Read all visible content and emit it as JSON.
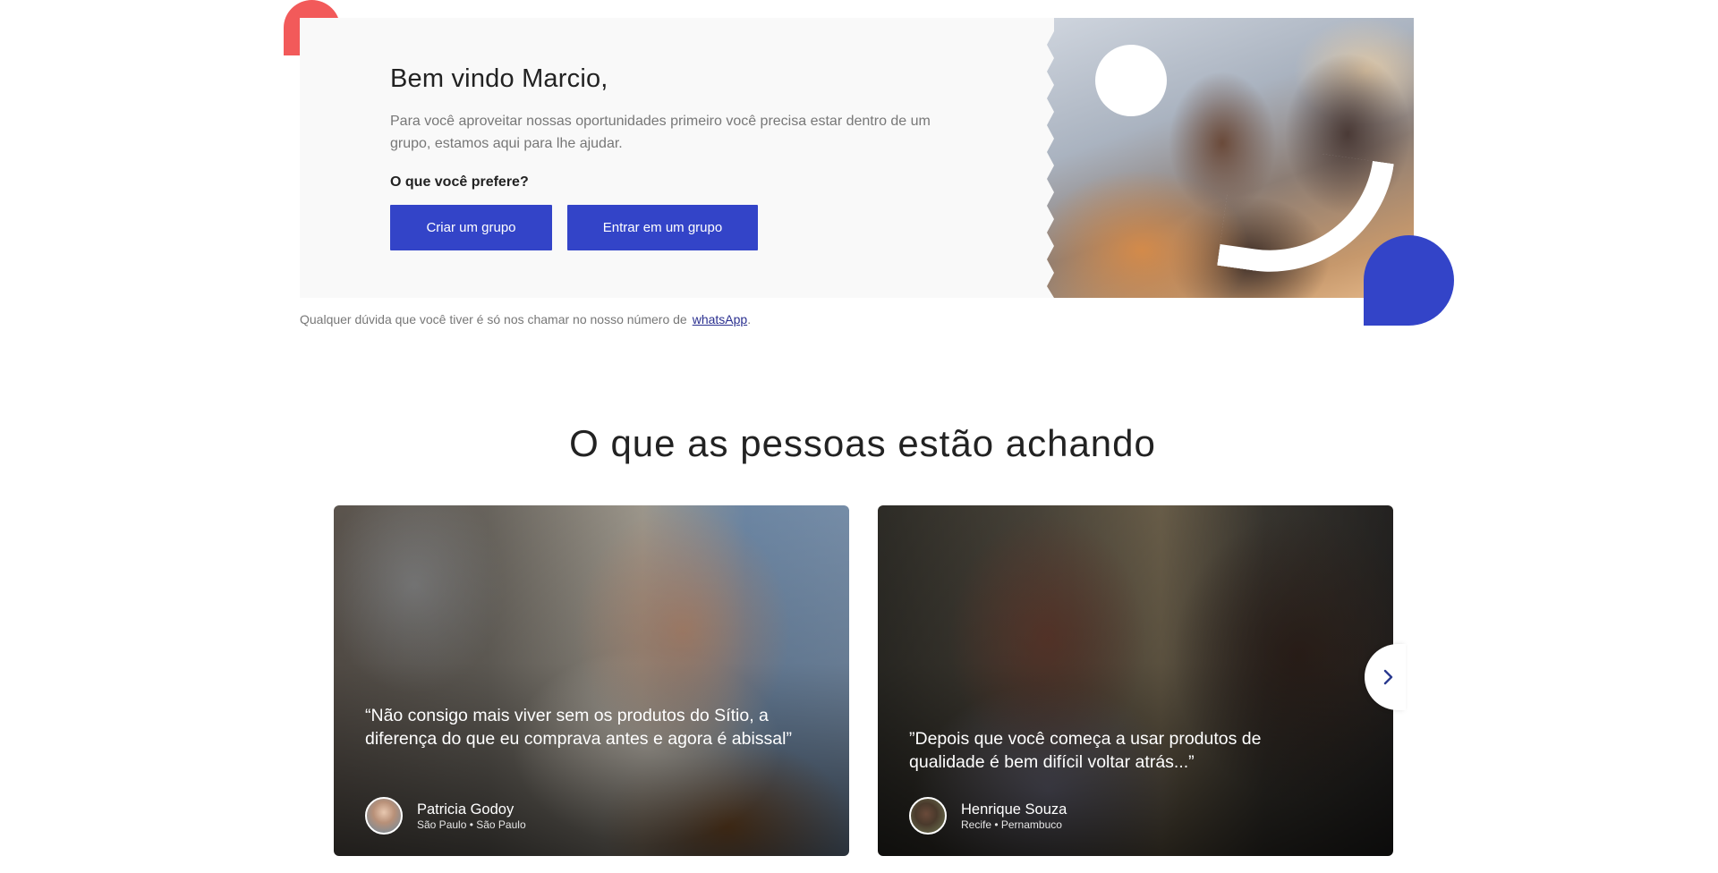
{
  "welcome": {
    "title": "Bem vindo Marcio,",
    "description": "Para você aproveitar nossas oportunidades primeiro você precisa estar dentro de um grupo, estamos aqui para lhe ajudar.",
    "question": "O que você prefere?",
    "create_button": "Criar um grupo",
    "join_button": "Entrar em um grupo",
    "help_text": "Qualquer dúvida que você tiver é só nos chamar no nosso número de",
    "help_link": "whatsApp",
    "help_suffix": "."
  },
  "colors": {
    "primary": "#3344c8",
    "accent_red": "#f25a5a",
    "link": "#2a2f8f"
  },
  "testimonials": {
    "title": "O que as pessoas estão achando",
    "items": [
      {
        "quote": "“Não consigo mais viver sem os produtos do Sítio, a diferença do que eu comprava antes e agora é abissal”",
        "name": "Patricia Godoy",
        "location": "São Paulo • São Paulo"
      },
      {
        "quote": "”Depois que você começa a usar produtos de qualidade é bem difícil voltar atrás...”",
        "name": "Henrique Souza",
        "location": "Recife • Pernambuco"
      }
    ],
    "next_icon": "chevron-right-icon"
  }
}
